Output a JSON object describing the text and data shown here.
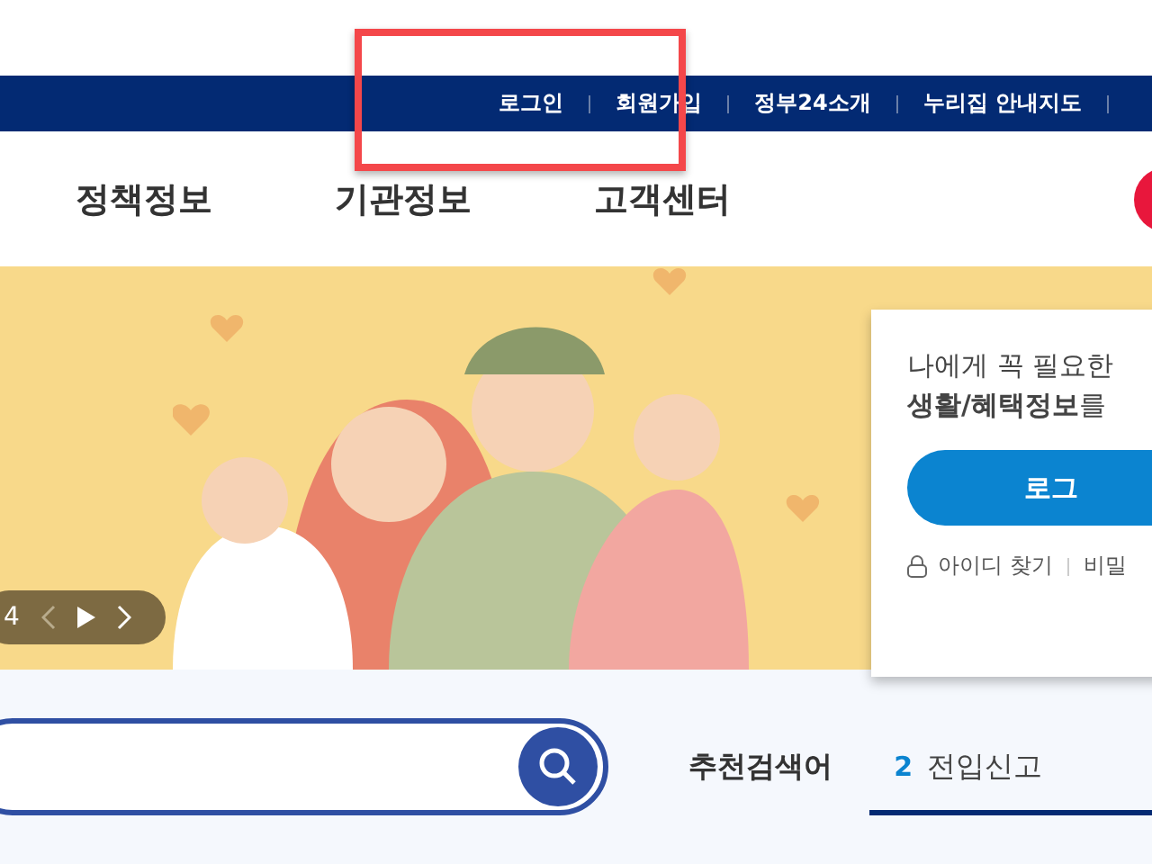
{
  "utility_links": [
    "로그인",
    "회원가입",
    "정부24소개",
    "누리집 안내지도"
  ],
  "main_nav": [
    "정책정보",
    "기관정보",
    "고객센터"
  ],
  "banner": {
    "slide_counter": "4",
    "playing": false
  },
  "login_card": {
    "intro": "나에게 꼭 필요한",
    "intro_bold": "**생활/혜택정보**를",
    "login_button": "로그",
    "find_id": "아이디 찾기",
    "find_password": "비밀"
  },
  "recommended": {
    "label": "추천검색어",
    "items": [
      {
        "rank": "2",
        "term": "전입신고"
      }
    ]
  }
}
